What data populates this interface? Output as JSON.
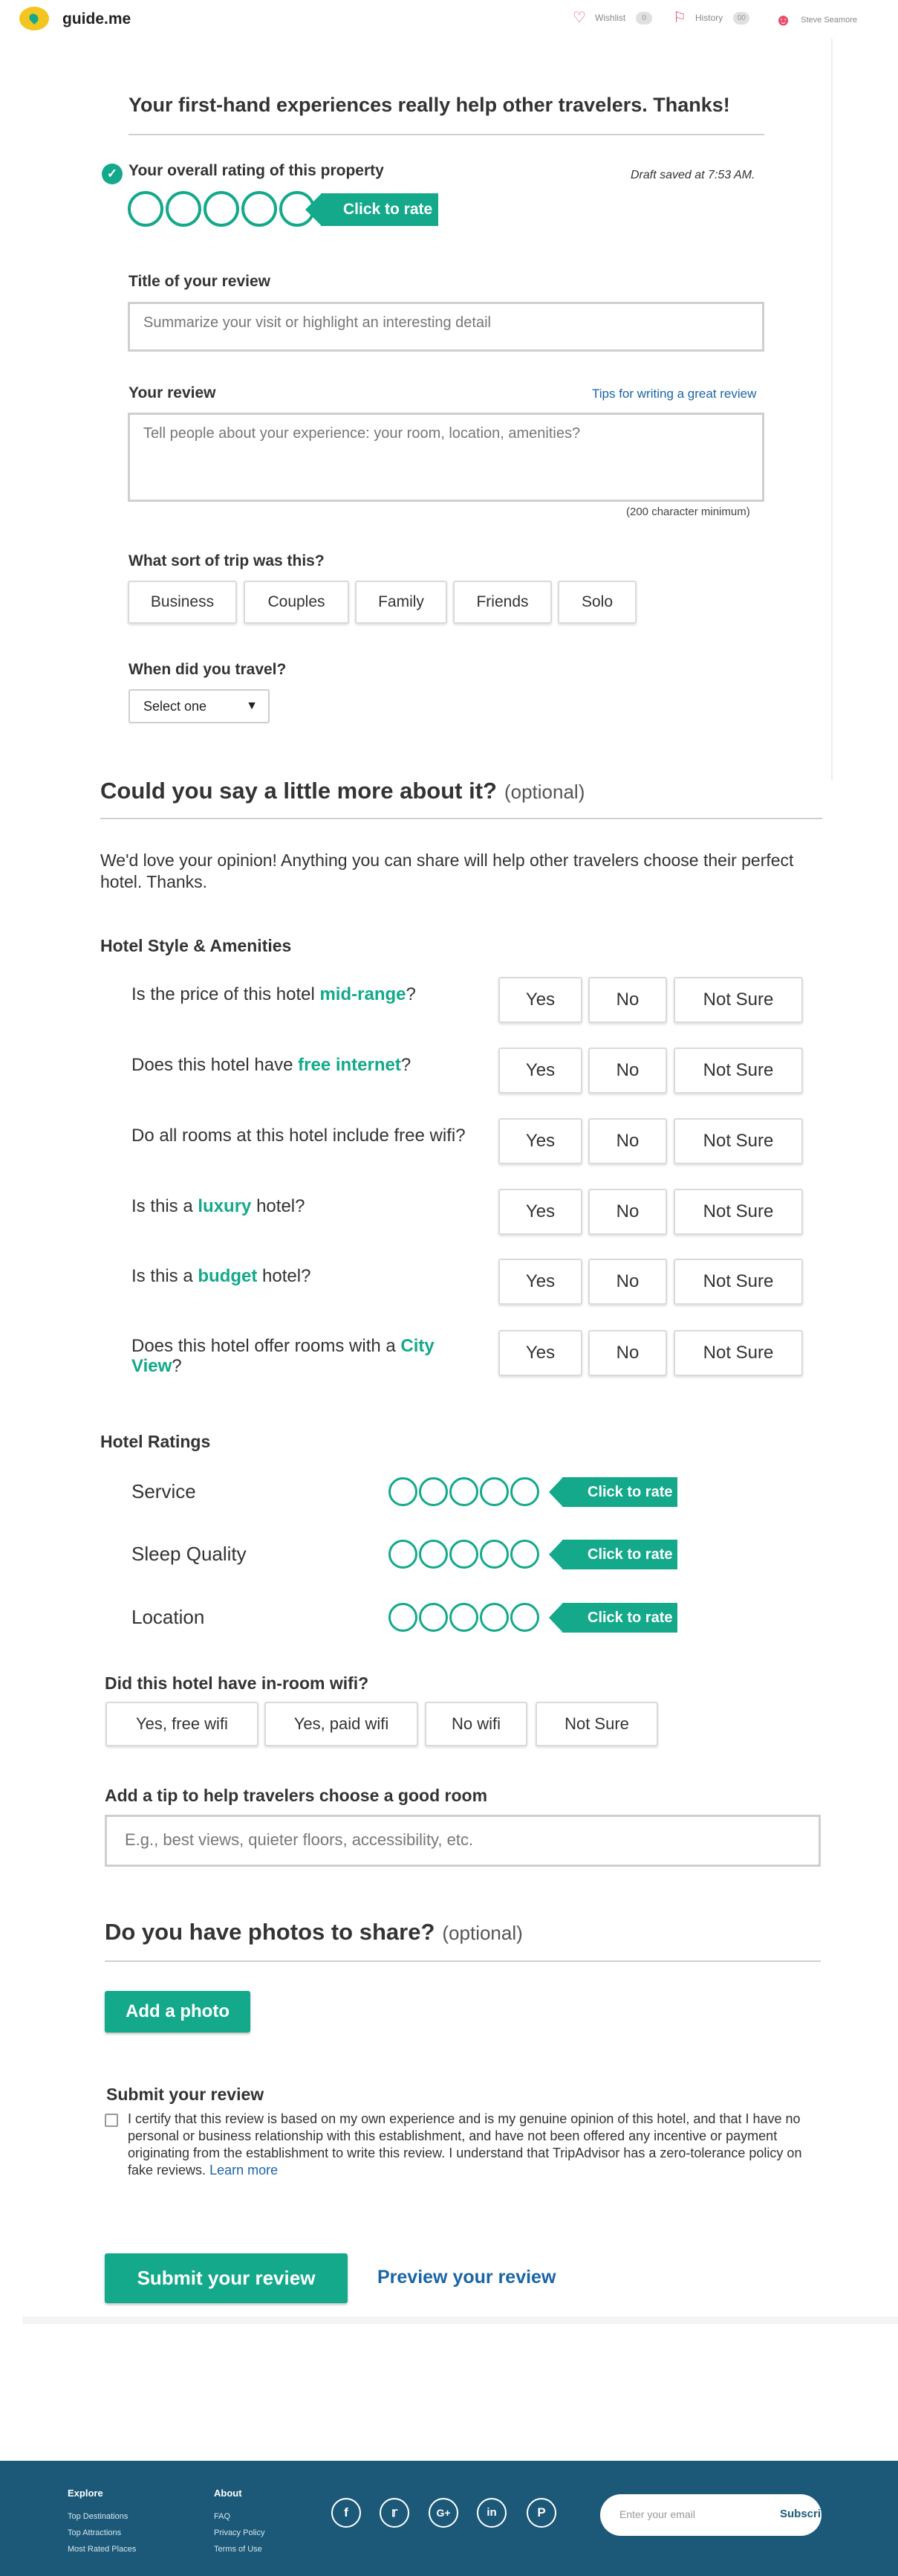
{
  "header": {
    "brand": "guide.me",
    "wishlist": {
      "label": "Wishlist",
      "count": "0"
    },
    "history": {
      "label": "History",
      "count": "00"
    },
    "user": "Steve Seamore"
  },
  "form": {
    "heading": "Your first-hand experiences really help other travelers. Thanks!",
    "overall_label": "Your overall rating of this property",
    "draft_saved": "Draft saved at 7:53 AM.",
    "click_to_rate": "Click to rate",
    "title_label": "Title of your review",
    "title_placeholder": "Summarize your visit or highlight an interesting detail",
    "review_label": "Your review",
    "tips_link": "Tips for writing a great review",
    "review_placeholder": "Tell people about your experience: your room, location, amenities?",
    "min_chars": "(200 character minimum)",
    "trip_label": "What sort of trip was this?",
    "trip_types": [
      "Business",
      "Couples",
      "Family",
      "Friends",
      "Solo"
    ],
    "travel_label": "When did you travel?",
    "travel_select": "Select one"
  },
  "more": {
    "heading": "Could you say a little more about it?",
    "optional": "(optional)",
    "intro": "We'd love your opinion! Anything you can share will help other travelers choose their perfect hotel. Thanks.",
    "style_heading": "Hotel Style & Amenities",
    "answer_labels": [
      "Yes",
      "No",
      "Not Sure"
    ],
    "questions": [
      {
        "pre": "Is the price of this hotel ",
        "hl": "mid-range",
        "post": "?"
      },
      {
        "pre": "Does this hotel have ",
        "hl": "free internet",
        "post": "?"
      },
      {
        "pre": "Do all rooms at this hotel include free wifi?",
        "hl": "",
        "post": ""
      },
      {
        "pre": "Is this a ",
        "hl": "luxury",
        "post": " hotel?"
      },
      {
        "pre": "Is this a ",
        "hl": "budget",
        "post": " hotel?"
      },
      {
        "pre": "Does this hotel offer rooms with a ",
        "hl": "City View",
        "post": "?"
      }
    ],
    "ratings_heading": "Hotel Ratings",
    "ratings": [
      "Service",
      "Sleep Quality",
      "Location"
    ],
    "wifi_heading": "Did this hotel have in-room wifi?",
    "wifi_options": [
      "Yes, free wifi",
      "Yes, paid wifi",
      "No wifi",
      "Not Sure"
    ],
    "tip_heading": "Add a tip to help travelers choose a good room",
    "tip_placeholder": "E.g., best views, quieter floors, accessibility, etc."
  },
  "photos": {
    "heading": "Do you have photos to share?",
    "optional": "(optional)",
    "add_button": "Add a photo"
  },
  "submit": {
    "heading": "Submit your review",
    "certify": "I certify that this review is based on my own experience and is my genuine opinion of this hotel, and that I have no personal or business relationship with this establishment, and have not been offered any incentive or payment originating from the establishment to write this review. I understand that TripAdvisor has a zero-tolerance policy on fake reviews.",
    "learn_more": "Learn more",
    "submit_button": "Submit your review",
    "preview_link": "Preview your review"
  },
  "footer": {
    "explore_title": "Explore",
    "explore_links": [
      "Top Destinations",
      "Top Attractions",
      "Most Rated Places"
    ],
    "about_title": "About",
    "about_links": [
      "FAQ",
      "Privacy Policy",
      "Terms of Use"
    ],
    "social_icons": [
      "facebook-icon",
      "twitter-icon",
      "google-plus-icon",
      "linkedin-icon",
      "pinterest-icon"
    ],
    "email_placeholder": "Enter your email",
    "subscribe": "Subscribe"
  },
  "colors": {
    "accent": "#13a98a",
    "link": "#1a65a6",
    "footer": "#1c5978",
    "heart": "#e74c6b"
  }
}
